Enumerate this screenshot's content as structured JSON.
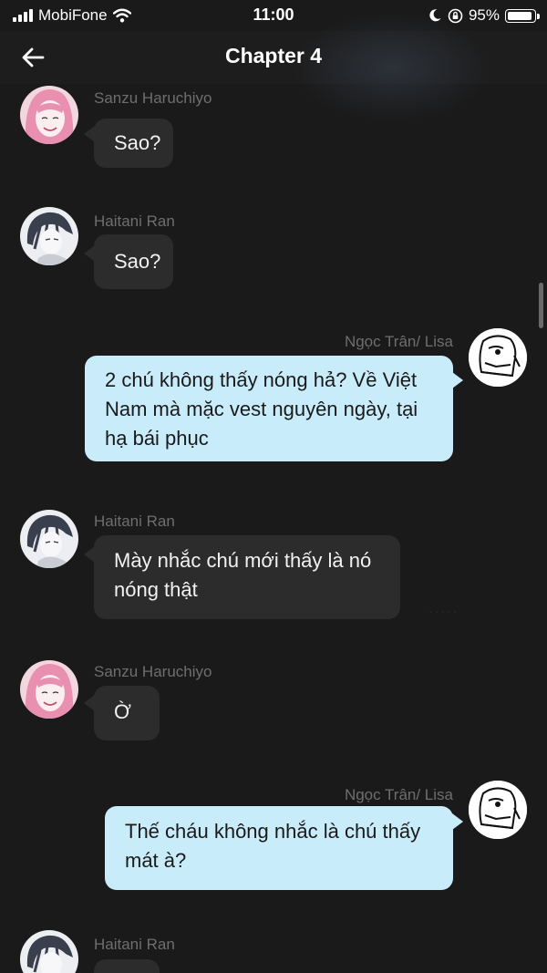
{
  "status_bar": {
    "carrier": "MobiFone",
    "time": "11:00",
    "battery_percent": "95%",
    "battery_level": 0.95
  },
  "nav": {
    "title": "Chapter 4"
  },
  "messages": [
    {
      "sender": "Sanzu Haruchiyo",
      "side": "left",
      "text": "Sao?",
      "avatar": "sanzu-avatar"
    },
    {
      "sender": "Haitani Ran",
      "side": "left",
      "text": "Sao?",
      "avatar": "ran-avatar"
    },
    {
      "sender": "Ngọc Trân/ Lisa",
      "side": "right",
      "lines": [
        "2 chú không thấy nóng hả? Về Việt",
        "Nam mà mặc vest nguyên ngày, tại",
        "hạ bái phục"
      ],
      "avatar": "lisa-avatar"
    },
    {
      "sender": "Haitani Ran",
      "side": "left",
      "lines": [
        "Mày nhắc chú mới thấy là nó",
        "nóng thật"
      ],
      "avatar": "ran-avatar"
    },
    {
      "sender": "Sanzu Haruchiyo",
      "side": "left",
      "text": "Ờ",
      "avatar": "sanzu-avatar"
    },
    {
      "sender": "Ngọc Trân/ Lisa",
      "side": "right",
      "lines": [
        "Thế cháu không nhắc là chú thấy",
        "mát à?"
      ],
      "avatar": "lisa-avatar"
    },
    {
      "sender": "Haitani Ran",
      "side": "left",
      "text": "",
      "avatar": "ran-avatar"
    }
  ],
  "colors": {
    "background": "#1a1a1a",
    "bubble_left": "#2c2c2c",
    "bubble_right": "#c9ecfa",
    "sender_name": "#6e6e6e"
  }
}
